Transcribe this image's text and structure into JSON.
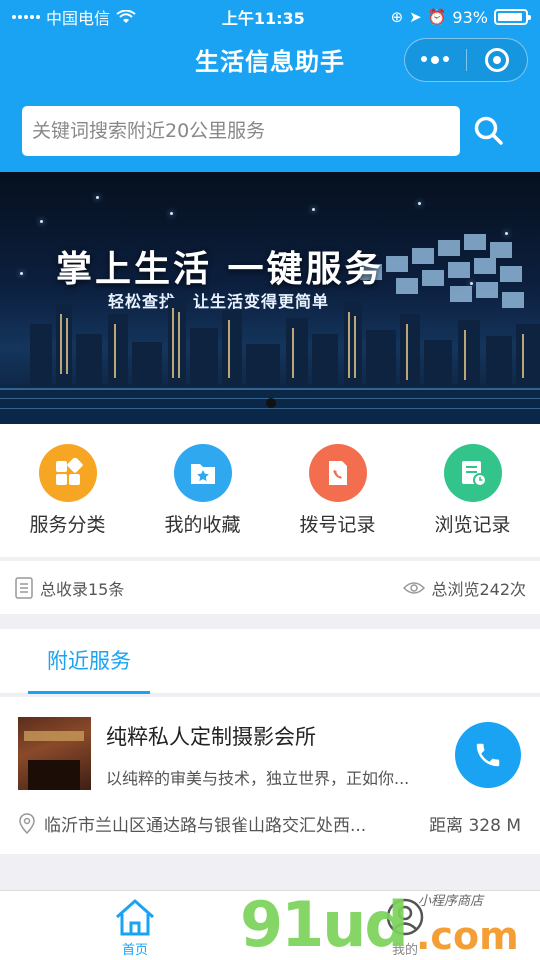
{
  "status_bar": {
    "carrier": "中国电信",
    "time": "上午11:35",
    "battery": "93%",
    "battery_level": 0.93
  },
  "header": {
    "title": "生活信息助手",
    "more_icon": "more-dots-icon",
    "close_icon": "target-ring-icon"
  },
  "search": {
    "placeholder": "关键词搜索附近20公里服务",
    "value": "",
    "button_icon": "search-icon"
  },
  "banner": {
    "headline": "掌上生活  一键服务",
    "subline": "轻松查找，让生活变得更简单",
    "pages": 1,
    "active_page": 1
  },
  "quick_menu": [
    {
      "label": "服务分类",
      "icon": "category-grid-icon",
      "color": "#f6a623"
    },
    {
      "label": "我的收藏",
      "icon": "favorite-folder-icon",
      "color": "#2fa8f0"
    },
    {
      "label": "拨号记录",
      "icon": "call-record-icon",
      "color": "#f36e4f"
    },
    {
      "label": "浏览记录",
      "icon": "browse-history-icon",
      "color": "#33c48b"
    }
  ],
  "stats": {
    "total_records": "总收录15条",
    "total_views": "总浏览242次"
  },
  "nearby": {
    "tab_label": "附近服务",
    "items": [
      {
        "name": "纯粹私人定制摄影会所",
        "desc": "以纯粹的审美与技术，独立世界，正如你...",
        "address": "临沂市兰山区通达路与银雀山路交汇处西...",
        "distance": "距离  328 M"
      }
    ]
  },
  "tabbar": {
    "home": "首页",
    "mine": "我的"
  },
  "watermark": {
    "brand": "91ud",
    "suffix": ".com",
    "small": "小程序商店"
  },
  "colors": {
    "primary": "#1aa3f3",
    "background": "#efeff4"
  }
}
